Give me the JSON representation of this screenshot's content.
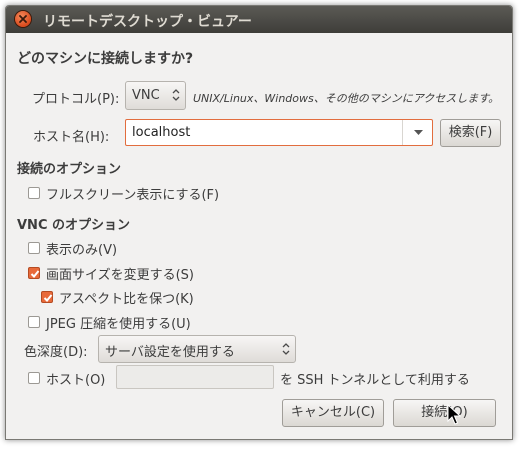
{
  "window": {
    "title": "リモートデスクトップ・ビュアー"
  },
  "heading": "どのマシンに接続しますか?",
  "protocol": {
    "label": "プロトコル(P):",
    "value": "VNC",
    "description": "UNIX/Linux、Windows、その他のマシンにアクセスします。"
  },
  "host": {
    "label": "ホスト名(H):",
    "value": "localhost",
    "find_button": "検索(F)"
  },
  "connection_options": {
    "heading": "接続のオプション",
    "fullscreen": {
      "label": "フルスクリーン表示にする(F)",
      "checked": false
    }
  },
  "vnc_options": {
    "heading": "VNC のオプション",
    "view_only": {
      "label": "表示のみ(V)",
      "checked": false
    },
    "scaling": {
      "label": "画面サイズを変更する(S)",
      "checked": true
    },
    "keep_aspect": {
      "label": "アスペクト比を保つ(K)",
      "checked": true
    },
    "jpeg": {
      "label": "JPEG 圧縮を使用する(U)",
      "checked": false
    },
    "depth": {
      "label": "色深度(D):",
      "value": "サーバ設定を使用する"
    },
    "ssh": {
      "label": "ホスト(O)",
      "host_value": "",
      "suffix": "を SSH トンネルとして利用する",
      "checked": false
    }
  },
  "buttons": {
    "cancel": "キャンセル(C)",
    "connect": "接続(O)"
  },
  "colors": {
    "accent": "#e86a3a",
    "titlebar": "#3e3d39",
    "dialog_bg": "#f2f1f0"
  }
}
